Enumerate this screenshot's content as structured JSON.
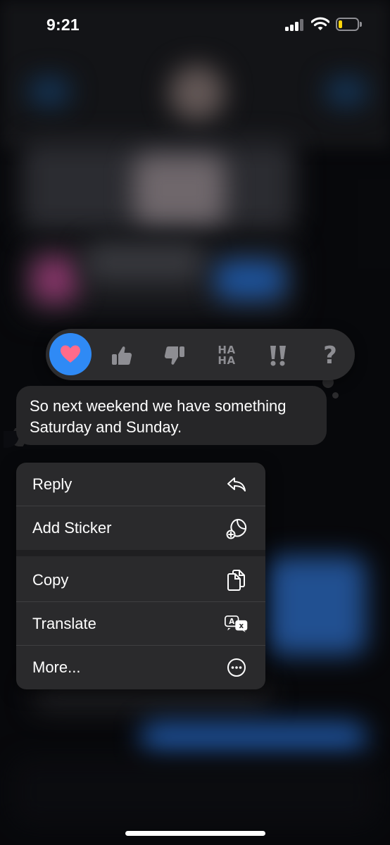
{
  "status_bar": {
    "time": "9:21",
    "icons": [
      "cellular-signal-icon",
      "wifi-icon",
      "battery-low-icon"
    ],
    "battery_color": "#ffd60a"
  },
  "tapbacks": {
    "items": [
      {
        "name": "heart",
        "selected": true
      },
      {
        "name": "thumbs-up",
        "selected": false
      },
      {
        "name": "thumbs-down",
        "selected": false
      },
      {
        "name": "haha",
        "text_line1": "HA",
        "text_line2": "HA",
        "selected": false
      },
      {
        "name": "exclamation",
        "selected": false
      },
      {
        "name": "question",
        "text": "?",
        "selected": false
      }
    ],
    "selected_color": "#2f8af5",
    "heart_color": "#ff6b8a"
  },
  "message": {
    "text": "So next weekend we have something Saturday and Sunday."
  },
  "context_menu": {
    "items": [
      {
        "label": "Reply",
        "icon": "reply-icon"
      },
      {
        "label": "Add Sticker",
        "icon": "add-sticker-icon"
      },
      {
        "label": "Copy",
        "icon": "copy-icon"
      },
      {
        "label": "Translate",
        "icon": "translate-icon"
      },
      {
        "label": "More...",
        "icon": "more-icon"
      }
    ]
  }
}
